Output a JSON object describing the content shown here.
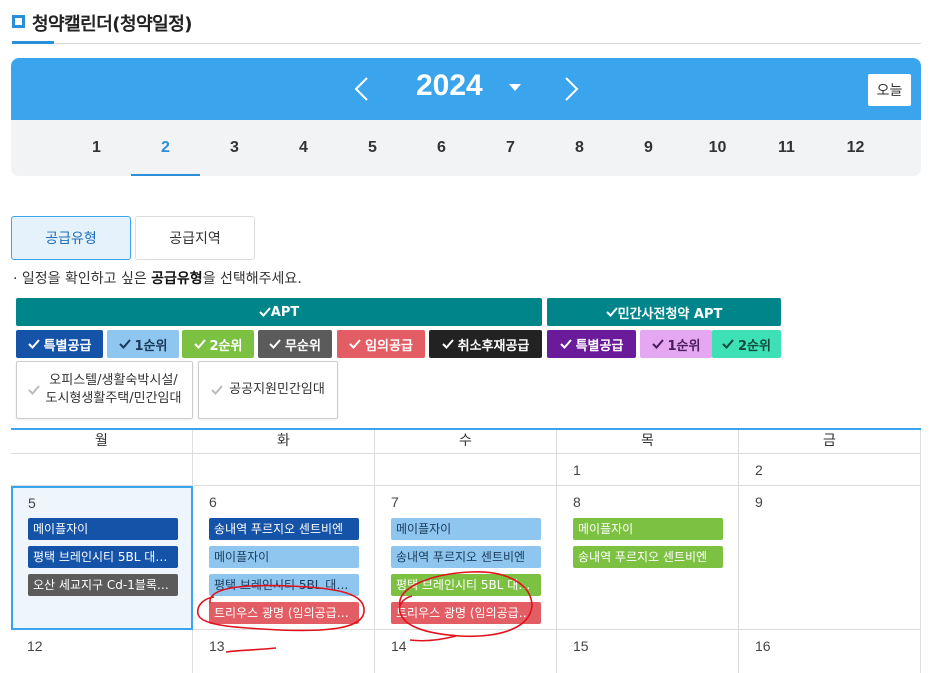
{
  "header": {
    "title": "청약캘린더(청약일정)"
  },
  "year_nav": {
    "year": "2024",
    "today_label": "오늘"
  },
  "months": [
    "1",
    "2",
    "3",
    "4",
    "5",
    "6",
    "7",
    "8",
    "9",
    "10",
    "11",
    "12"
  ],
  "active_month": "2",
  "tabs": [
    {
      "label": "공급유형",
      "active": true
    },
    {
      "label": "공급지역",
      "active": false
    }
  ],
  "instruction": {
    "prefix": "· 일정을 확인하고 싶은 ",
    "bold": "공급유형",
    "suffix": "을 선택해주세요."
  },
  "groups": [
    {
      "label": "APT"
    },
    {
      "label": "민간사전청약 APT"
    }
  ],
  "chips": [
    {
      "label": "특별공급",
      "color": "#1453a8"
    },
    {
      "label": "1순위",
      "color": "#8ec6ef"
    },
    {
      "label": "2순위",
      "color": "#7dc142"
    },
    {
      "label": "무순위",
      "color": "#5b5b5b"
    },
    {
      "label": "임의공급",
      "color": "#e35e64"
    },
    {
      "label": "취소후재공급",
      "color": "#222222"
    },
    {
      "label": "특별공급",
      "color": "#6a1b9a"
    },
    {
      "label": "1순위",
      "color": "#e5a6f2"
    },
    {
      "label": "2순위",
      "color": "#3ee0b6"
    }
  ],
  "other_chips": [
    {
      "line1": "오피스텔/생활숙박시설/",
      "line2": "도시형생활주택/민간임대"
    },
    {
      "line1": "공공지원민간임대"
    }
  ],
  "calendar": {
    "weekdays": [
      "월",
      "화",
      "수",
      "목",
      "금"
    ],
    "rows": [
      [
        "",
        "",
        "",
        "1",
        "2"
      ],
      [
        "5",
        "6",
        "7",
        "8",
        "9"
      ],
      [
        "12",
        "13",
        "14",
        "15",
        "16"
      ]
    ],
    "events": {
      "5": [
        "메이플자이",
        "평택 브레인시티 5BL 대…",
        "오산 세교지구 Cd-1블록…"
      ],
      "6": [
        "송내역 푸르지오 센트비엔",
        "메이플자이",
        "평택 브레인시티 5BL 대…",
        "트리우스 광명 (임의공급…"
      ],
      "7": [
        "메이플자이",
        "송내역 푸르지오 센트비엔",
        "평택 브레인시티 5BL 대…",
        "트리우스 광명 (임의공급…"
      ],
      "8": [
        "메이플자이",
        "송내역 푸르지오 센트비엔"
      ]
    }
  },
  "colors": {
    "accent": "#3aa5ec",
    "teal": "#00868a",
    "annotation": "#e0141e"
  }
}
